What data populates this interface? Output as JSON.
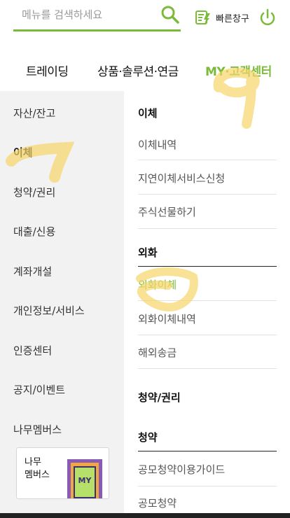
{
  "header": {
    "search_placeholder": "메뉴를 검색하세요",
    "quick_window_label": "빠른창구"
  },
  "gnb": [
    {
      "label": "트레이딩"
    },
    {
      "label": "상품·솔루션·연금"
    },
    {
      "label": "MY·고객센터"
    }
  ],
  "lnb": [
    {
      "label": "자산/잔고"
    },
    {
      "label": "이체"
    },
    {
      "label": "청약/권리"
    },
    {
      "label": "대출/신용"
    },
    {
      "label": "계좌개설"
    },
    {
      "label": "개인정보/서비스"
    },
    {
      "label": "인증센터"
    },
    {
      "label": "공지/이벤트"
    },
    {
      "label": "나무멤버스"
    }
  ],
  "banner": {
    "text": "나무\n멤버스",
    "badge": "MY"
  },
  "submenu": [
    {
      "label": "이체"
    },
    {
      "label": "이체내역"
    },
    {
      "label": "지연이체서비스신청"
    },
    {
      "label": "주식선물하기"
    },
    {
      "label": "외화"
    },
    {
      "label": "외화이체"
    },
    {
      "label": "외화이체내역"
    },
    {
      "label": "해외송금"
    },
    {
      "label": "청약/권리"
    },
    {
      "label": "청약"
    },
    {
      "label": "공모청약이용가이드"
    },
    {
      "label": "공모청약"
    }
  ],
  "colors": {
    "accent": "#7cba3a",
    "highlighter": "#f6d66a"
  }
}
